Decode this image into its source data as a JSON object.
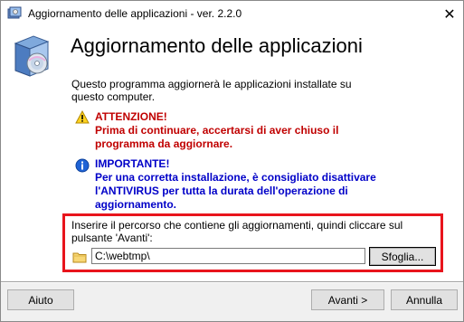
{
  "window": {
    "title": "Aggiornamento delle applicazioni - ver. 2.2.0",
    "close_glyph": "✕"
  },
  "header": {
    "heading": "Aggiornamento delle applicazioni",
    "icon": "software-installer-icon"
  },
  "intro": {
    "text": "Questo programma aggiornerà le applicazioni installate su questo computer."
  },
  "warning": {
    "icon": "warning-triangle-icon",
    "title": "ATTENZIONE!",
    "body": "Prima di continuare, accertarsi di aver chiuso il programma da aggiornare.",
    "color": "#c00000"
  },
  "info": {
    "icon": "info-icon",
    "title": "IMPORTANTE!",
    "body": "Per una corretta installazione, è consigliato disattivare l'ANTIVIRUS per tutta la durata dell'operazione di aggiornamento.",
    "color": "#0000c8"
  },
  "path": {
    "label": "Inserire il percorso che contiene gli aggiornamenti, quindi cliccare sul pulsante 'Avanti':",
    "value": "C:\\webtmp\\",
    "folder_icon": "folder-icon",
    "browse_label": "Sfoglia...",
    "highlight_color": "#e8141c"
  },
  "footer": {
    "help_label": "Aiuto",
    "next_label": "Avanti >",
    "cancel_label": "Annulla"
  }
}
